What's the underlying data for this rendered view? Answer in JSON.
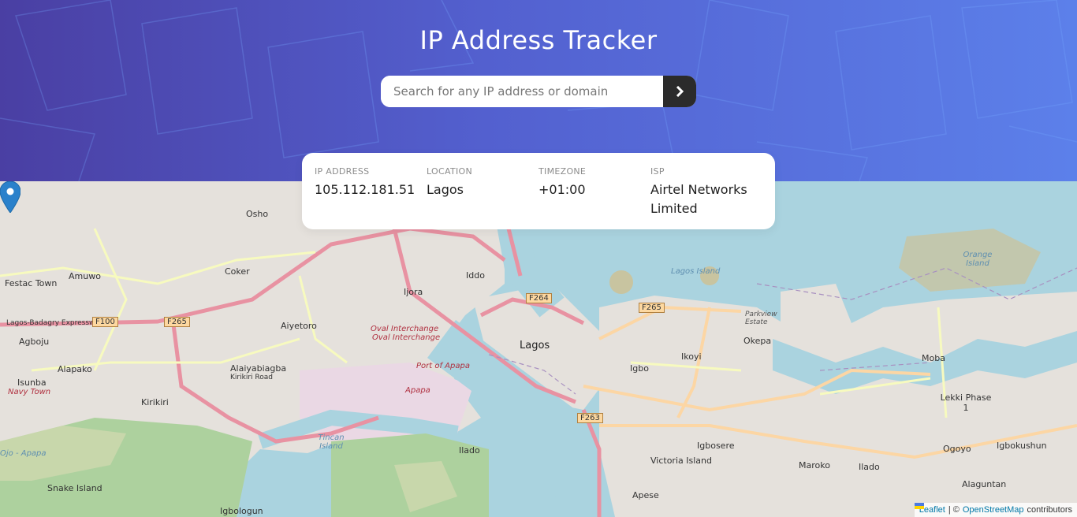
{
  "header": {
    "title": "IP Address Tracker",
    "search_placeholder": "Search for any IP address or domain",
    "search_value": "",
    "submit_icon": "chevron-right-icon",
    "gradient": [
      "#4a3fa3",
      "#5c80ea"
    ]
  },
  "info": [
    {
      "label": "IP ADDRESS",
      "value": "105.112.181.51"
    },
    {
      "label": "LOCATION",
      "value": "Lagos"
    },
    {
      "label": "TIMEZONE",
      "value": "+01:00"
    },
    {
      "label": "ISP",
      "value": "Airtel Networks Limited"
    }
  ],
  "map": {
    "places": {
      "osho": "Osho",
      "festac": "Festac Town",
      "amuwo": "Amuwo",
      "coker": "Coker",
      "ijora": "Ijora",
      "iddo": "Iddo",
      "aiyetoro": "Aiyetoro",
      "agboju": "Agboju",
      "alapako": "Alapako",
      "isunba": "Isunba",
      "navytown": "Navy Town",
      "kirikiri": "Kirikiri",
      "alaiyabiagba": "Alaiyabiagba",
      "kirikiriroad": "Kirikiri Road",
      "lagos": "Lagos",
      "ikoyi": "Ikoyi",
      "igbo": "Igbo",
      "okepa": "Okepa",
      "parkview": "Parkview Estate",
      "mobа": "Moba",
      "lekki": "Lekki Phase 1",
      "ogoyo": "Ogoyo",
      "igbokushun": "Igbokushun",
      "alaguntan": "Alaguntan",
      "maroko": "Maroko",
      "ilado2": "Ilado",
      "victoria": "Victoria Island",
      "igbosere": "Igbosere",
      "apese": "Apese",
      "ilado": "Ilado",
      "tincan": "Tincan Island",
      "snake": "Snake Island",
      "igbologun": "Igbologun",
      "apapa": "Apapa",
      "portapapa": "Port of Apapa",
      "oval1": "Oval Interchange",
      "oval2": "Oval Interchange",
      "lagoslagoon": "Lagos Island",
      "orange": "Orange Island",
      "apapa_road": "Ojo - Apapa",
      "lbex": "Lagos-Badagry Expressway"
    },
    "shields": {
      "f100": "F100",
      "f265a": "F265",
      "f264": "F264",
      "f265b": "F265",
      "f263": "F263"
    }
  },
  "attribution": {
    "leaflet": "Leaflet",
    "sep": "| ©",
    "osm": "OpenStreetMap",
    "contrib": "contributors"
  }
}
